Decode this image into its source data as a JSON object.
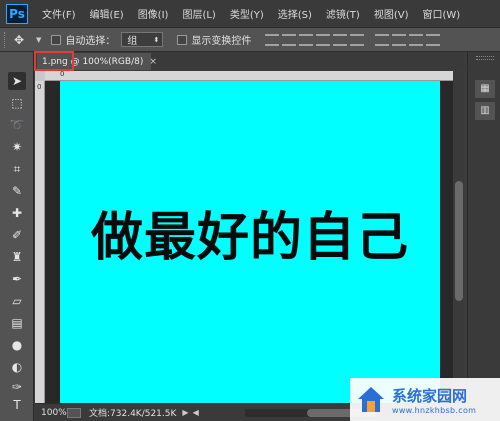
{
  "app": {
    "logo": "Ps"
  },
  "menu": [
    "文件(F)",
    "编辑(E)",
    "图像(I)",
    "图层(L)",
    "类型(Y)",
    "选择(S)",
    "滤镜(T)",
    "视图(V)",
    "窗口(W)"
  ],
  "options": {
    "auto_select_label": "自动选择：",
    "auto_select_value": "组",
    "show_transform_label": "显示变换控件"
  },
  "document": {
    "tab_label": "1.png @ 100%(RGB/8)",
    "close_glyph": "×",
    "canvas_text": "做最好的自己",
    "canvas_color": "#00ffff"
  },
  "ruler": {
    "origin": "0"
  },
  "status": {
    "zoom": "100%",
    "doc_size": "文档:732.4K/521.5K"
  },
  "watermark": {
    "title": "系统家园网",
    "url": "www.hnzkhbsb.com"
  },
  "colors": {
    "highlight": "#e33b3b",
    "ps_blue": "#31a8ff"
  }
}
